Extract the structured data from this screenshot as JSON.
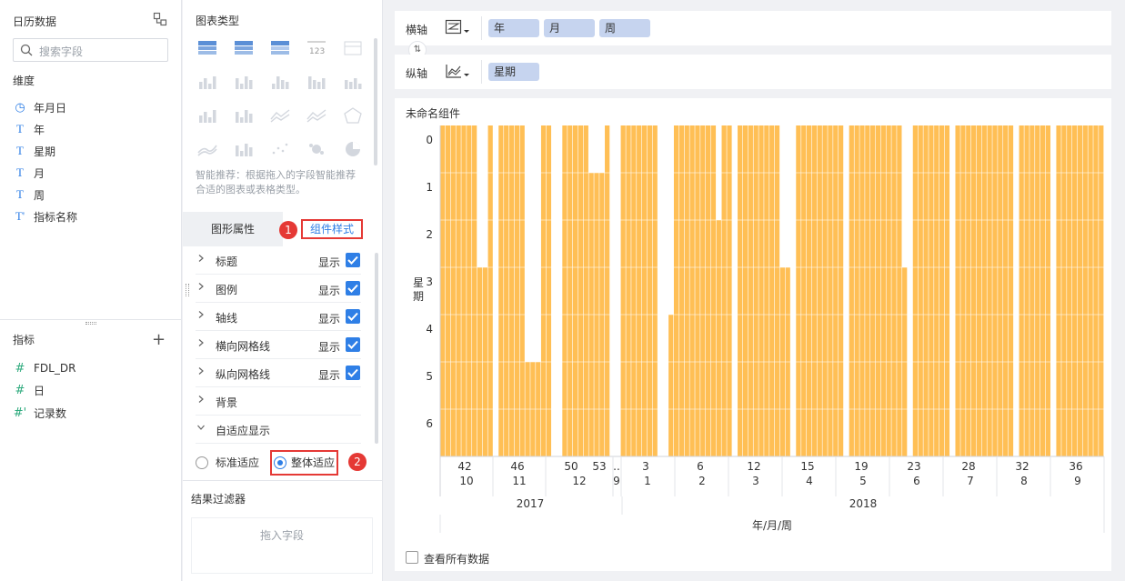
{
  "left_panel": {
    "title": "日历数据",
    "search_placeholder": "搜索字段",
    "dimensions_label": "维度",
    "dimensions": [
      {
        "icon": "clock-icon",
        "glyph": "◷",
        "label": "年月日"
      },
      {
        "icon": "text-type-icon",
        "glyph": "T",
        "label": "年"
      },
      {
        "icon": "text-type-icon",
        "glyph": "T",
        "label": "星期"
      },
      {
        "icon": "text-type-icon",
        "glyph": "T",
        "label": "月"
      },
      {
        "icon": "text-type-icon",
        "glyph": "T",
        "label": "周"
      },
      {
        "icon": "text-type-calc-icon",
        "glyph": "T'",
        "label": "指标名称"
      }
    ],
    "measures_label": "指标",
    "measures": [
      {
        "icon": "number-type-icon",
        "glyph": "#",
        "label": "FDL_DR"
      },
      {
        "icon": "number-type-icon",
        "glyph": "#",
        "label": "日"
      },
      {
        "icon": "number-type-calc-icon",
        "glyph": "#'",
        "label": "记录数"
      }
    ]
  },
  "middle_panel": {
    "chart_type_title": "图表类型",
    "chart_hint": "智能推荐：根据拖入的字段智能推荐合适的图表或表格类型。",
    "tabs": {
      "attr": "图形属性",
      "style": "组件样式"
    },
    "badges": [
      "1",
      "2"
    ],
    "properties": [
      {
        "label": "标题",
        "show": "显示",
        "checked": true
      },
      {
        "label": "图例",
        "show": "显示",
        "checked": true
      },
      {
        "label": "轴线",
        "show": "显示",
        "checked": true
      },
      {
        "label": "横向网格线",
        "show": "显示",
        "checked": true
      },
      {
        "label": "纵向网格线",
        "show": "显示",
        "checked": true
      },
      {
        "label": "背景",
        "show": "",
        "checked": false
      },
      {
        "label": "自适应显示",
        "show": "",
        "checked": false,
        "expanded": true
      }
    ],
    "adapt_options": [
      {
        "label": "标准适应",
        "selected": false
      },
      {
        "label": "整体适应",
        "selected": true
      }
    ],
    "result_filter_title": "结果过滤器",
    "drop_zone_text": "拖入字段"
  },
  "axes": {
    "horizontal_label": "横轴",
    "horizontal_fields": [
      "年",
      "月",
      "周"
    ],
    "vertical_label": "纵轴",
    "vertical_fields": [
      "星期"
    ]
  },
  "chart": {
    "component_title": "未命名组件",
    "view_all_label": "查看所有数据"
  },
  "chart_data": {
    "type": "bar",
    "ylabel": "星期",
    "xlabel": "年/月/周",
    "y_categories": [
      "0",
      "1",
      "2",
      "3",
      "4",
      "5",
      "6"
    ],
    "x_levels": {
      "week_labels": [
        "42",
        "46",
        "50",
        "53",
        "..",
        "3",
        "6",
        "12",
        "15",
        "19",
        "23",
        "28",
        "32",
        "36"
      ],
      "month_labels": [
        "10",
        "11",
        "12",
        "9",
        "1",
        "2",
        "3",
        "4",
        "5",
        "6",
        "7",
        "8",
        "9"
      ],
      "year_labels": [
        "2017",
        "2018"
      ]
    },
    "bar_color": "#ffbf55",
    "columns_top_weekday": [
      0,
      0,
      0,
      0,
      0,
      0,
      0,
      3,
      3,
      0,
      0,
      0,
      0,
      0,
      0,
      0,
      5,
      5,
      5,
      0,
      0,
      0,
      0,
      0,
      0,
      0,
      0,
      0,
      1,
      1,
      1,
      0,
      0,
      0,
      0,
      0,
      0,
      0,
      0,
      0,
      0,
      4,
      4,
      4,
      0,
      0,
      0,
      0,
      0,
      0,
      0,
      0,
      2,
      0,
      0,
      0,
      0,
      0,
      0,
      0,
      0,
      0,
      0,
      0,
      3,
      3,
      0,
      0,
      0,
      0,
      0,
      0,
      0,
      0,
      0,
      0,
      0,
      0,
      0,
      0,
      0,
      0,
      0,
      0,
      0,
      0,
      0,
      3,
      0,
      0,
      0,
      0,
      0,
      0,
      0,
      0,
      0,
      0,
      0,
      0,
      0,
      0,
      0,
      0,
      0,
      0,
      0,
      0,
      0,
      0,
      0,
      0,
      0,
      0,
      0,
      0,
      0,
      0,
      0,
      0,
      0,
      0,
      0,
      0,
      0,
      0,
      0,
      0,
      0,
      0,
      0,
      0,
      0,
      0,
      0,
      0,
      0,
      0,
      0,
      0,
      0,
      0,
      0,
      0,
      0,
      0,
      0,
      0,
      0,
      0,
      0,
      0,
      0,
      0,
      0,
      0,
      0,
      0,
      0,
      0,
      0,
      0,
      0,
      0,
      0,
      0,
      0,
      0,
      0,
      0,
      0,
      0,
      0,
      0,
      0,
      0,
      0,
      0,
      0,
      0,
      0,
      0,
      0,
      0,
      0,
      0,
      0,
      0,
      0,
      0,
      0,
      0,
      0,
      0,
      0,
      0,
      0,
      0,
      0,
      0,
      0,
      0,
      0,
      0,
      0,
      0,
      0,
      0,
      0,
      0,
      0,
      0,
      0,
      0,
      0,
      0,
      0
    ]
  }
}
